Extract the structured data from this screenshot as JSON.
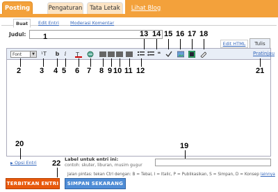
{
  "top_tabs": {
    "posting": "Posting",
    "pengaturan": "Pengaturan",
    "tata_letak": "Tata Letak",
    "lihat_blog": "Lihat Blog"
  },
  "sub_tabs": {
    "buat": "Buat",
    "edit_entri": "Edit Entri",
    "moderasi": "Moderasi Komentar"
  },
  "form": {
    "title_label": "Judul:",
    "title_value": ""
  },
  "mode_tabs": {
    "edit_html": "Edit HTML",
    "tulis": "Tulis"
  },
  "toolbar": {
    "font_select": "Font",
    "font_size": "¹T",
    "bold": "b",
    "italic": "i",
    "preview": "Pratinjau"
  },
  "labels": {
    "opsi_entri": "Opsi Entri",
    "label_title": "Label untuk entri ini:",
    "label_example": "contoh: skuter, liburan, musim gugur"
  },
  "shortcuts": {
    "prefix": "Jalan pintas: tekan Ctrl dengan: B = Tebal, I = Italic, P = Publikasikan, S = Simpan, D = Konsep",
    "link": "lainnya"
  },
  "buttons": {
    "publish": "TERBITKAN ENTRI",
    "save": "SIMPAN SEKARANG"
  },
  "callouts": [
    "1",
    "2",
    "3",
    "4",
    "5",
    "6",
    "7",
    "8",
    "9",
    "10",
    "11",
    "12",
    "13",
    "14",
    "15",
    "16",
    "17",
    "18",
    "19",
    "20",
    "21",
    "22"
  ]
}
